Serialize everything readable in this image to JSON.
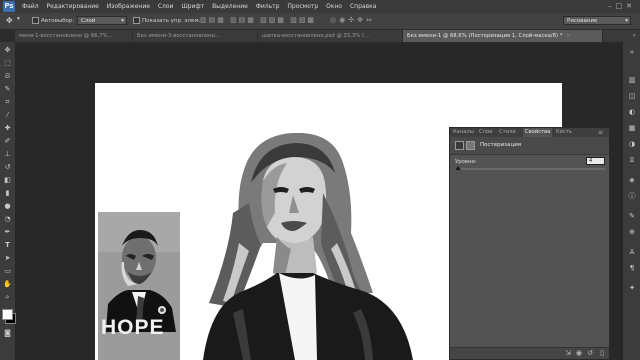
{
  "app": {
    "logo": "Ps"
  },
  "menu": [
    "Файл",
    "Редактирование",
    "Изображение",
    "Слои",
    "Шрифт",
    "Выделение",
    "Фильтр",
    "Просмотр",
    "Окно",
    "Справка"
  ],
  "options_bar": {
    "autoselect_label": "Автовыбор:",
    "autoselect_value": "Слой",
    "show_controls_label": "Показать упр. элем.",
    "workspace_value": "Рисование"
  },
  "document_tabs": [
    {
      "title": "мени-1-восстановлено @ 66,7%...",
      "active": false
    },
    {
      "title": "Без имени-3-восстановлено...",
      "active": false
    },
    {
      "title": "шапка-восстановлено.psd @ 33,3% (...",
      "active": false
    },
    {
      "title": "Без имени-1 @ 68,6% (Постеризация 1, Слой-маска/8) *",
      "active": true
    }
  ],
  "poster_text": "HOPE",
  "properties_panel": {
    "tabs": [
      "Каналы",
      "Слои",
      "Стили",
      "Свойства",
      "Кисть"
    ],
    "active_tab": "Свойства",
    "title": "Постеризация",
    "levels_label": "Уровни:",
    "levels_value": "4",
    "levels_slider_fraction": 0.02
  },
  "colors": {
    "accent": "#3b6fb0",
    "canvas_bg": "#ffffff"
  }
}
